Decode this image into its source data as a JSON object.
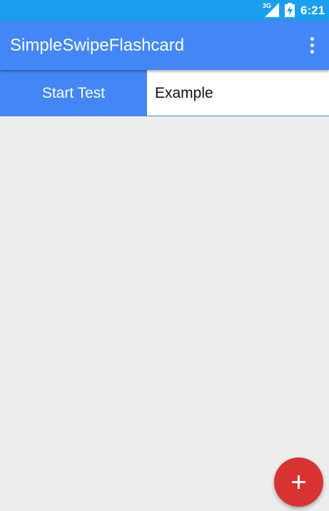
{
  "status_bar": {
    "network_type": "3G",
    "time": "6:21",
    "icons": [
      "signal-icon",
      "battery-charging-icon"
    ]
  },
  "app_bar": {
    "title": "SimpleSwipeFlashcard",
    "overflow_icon": "more-vert-icon"
  },
  "toolbar": {
    "start_test_label": "Start Test",
    "deck_name": "Example"
  },
  "fab": {
    "icon": "plus-icon"
  },
  "colors": {
    "status_bar": "#1a9ff0",
    "primary": "#4287f5",
    "fab": "#d93232",
    "background": "#ededee"
  }
}
